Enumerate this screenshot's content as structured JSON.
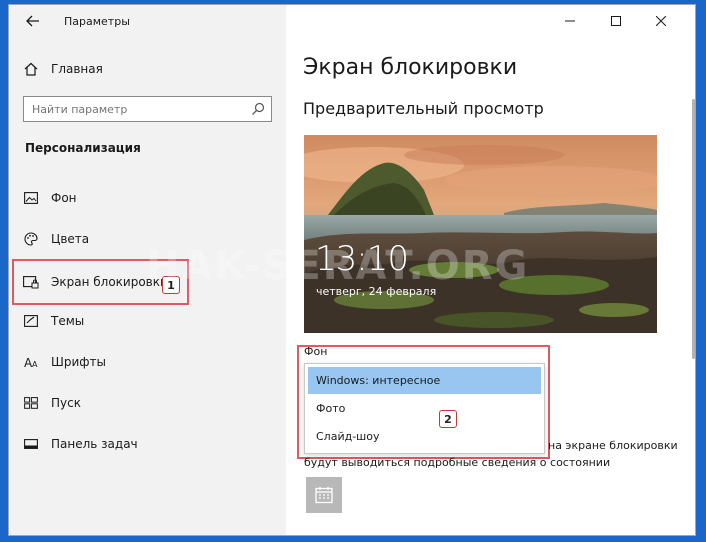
{
  "window": {
    "title": "Параметры",
    "controls": {
      "minimize": "minimize",
      "maximize": "maximize",
      "close": "close"
    }
  },
  "sidebar": {
    "home_label": "Главная",
    "search_placeholder": "Найти параметр",
    "section": "Персонализация",
    "items": [
      {
        "label": "Фон",
        "icon": "picture-icon"
      },
      {
        "label": "Цвета",
        "icon": "palette-icon"
      },
      {
        "label": "Экран блокировки",
        "icon": "lock-screen-icon"
      },
      {
        "label": "Темы",
        "icon": "brush-icon"
      },
      {
        "label": "Шрифты",
        "icon": "font-icon"
      },
      {
        "label": "Пуск",
        "icon": "start-icon"
      },
      {
        "label": "Панель задач",
        "icon": "taskbar-icon"
      }
    ]
  },
  "main": {
    "page_title": "Экран блокировки",
    "preview_heading": "Предварительный просмотр",
    "preview_clock": "13:10",
    "preview_date": "четверг, 24 февраля",
    "watermark": "HAK-SERAT.ORG",
    "background_label": "Фон",
    "background_options": [
      "Windows: интересное",
      "Фото",
      "Слайд-шоу"
    ],
    "selected_option": "Windows: интересное",
    "desc_line1_end": "на экране блокировки",
    "desc_line2": "будут выводиться подробные сведения о состоянии"
  },
  "annotations": {
    "badge1": "1",
    "badge2": "2",
    "highlight_color": "#e05a63"
  },
  "colors": {
    "frame": "#1a67c9",
    "sidebar_bg": "#f2f2f2",
    "selected_option_bg": "#99c6f0"
  }
}
